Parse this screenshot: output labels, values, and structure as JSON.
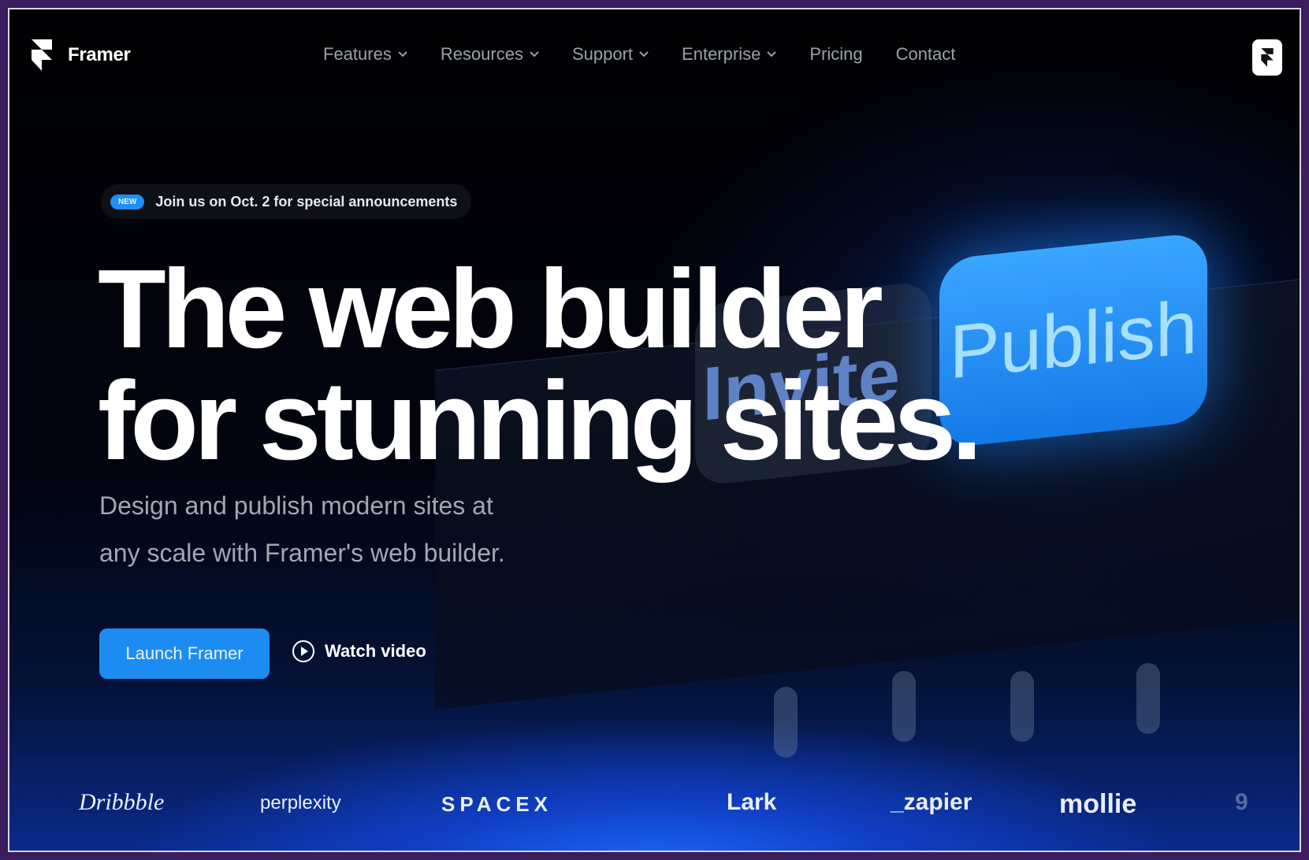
{
  "brand": {
    "name": "Framer",
    "logo_icon": "framer-logo-icon"
  },
  "nav": {
    "items": [
      {
        "label": "Features",
        "dropdown": true
      },
      {
        "label": "Resources",
        "dropdown": true
      },
      {
        "label": "Support",
        "dropdown": true
      },
      {
        "label": "Enterprise",
        "dropdown": true
      },
      {
        "label": "Pricing",
        "dropdown": false
      },
      {
        "label": "Contact",
        "dropdown": false
      }
    ],
    "cta_icon": "framer-app-icon"
  },
  "hero": {
    "badge_pill": "NEW",
    "badge_text": "Join us on Oct. 2 for special announcements",
    "headline_line1": "The web builder",
    "headline_line2": "for stunning sites.",
    "subtitle_line1": "Design and publish modern sites at",
    "subtitle_line2": "any scale with Framer's web builder.",
    "primary_button": "Launch Framer",
    "secondary_button": "Watch video",
    "secondary_icon": "play-circle-icon"
  },
  "visual": {
    "invite_label": "Invite",
    "publish_label": "Publish"
  },
  "customers": [
    "Dribbble",
    "perplexity",
    "SPACEX",
    "Lark",
    "_zapier",
    "mollie",
    "9"
  ],
  "colors": {
    "accent": "#1c8cf2",
    "background": "#020308",
    "glow": "#1f6cff",
    "text": "#ffffff",
    "muted": "#a3a7b1"
  }
}
